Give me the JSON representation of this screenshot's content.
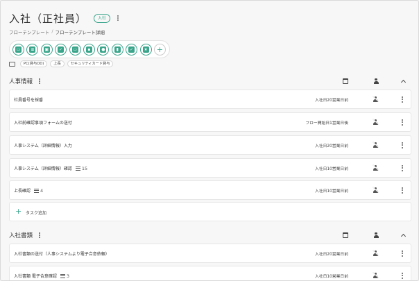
{
  "header": {
    "title": "入社（正社員）",
    "badge": "入社"
  },
  "breadcrumb": {
    "parent": "フローテンプレート",
    "separator": "/",
    "current": "フローテンプレート詳細"
  },
  "icon_group": {
    "icons": [
      "id-card-icon",
      "document-icon",
      "id-card-photo-icon",
      "shield-icon",
      "monitor-icon",
      "truck-icon",
      "person-icon",
      "book-icon",
      "clipboard-check-icon",
      "star-icon"
    ],
    "add_label": "+"
  },
  "tags": [
    "PC(貸与OD)",
    "上長",
    "セキュリティカード貸与"
  ],
  "sections": [
    {
      "title": "人事情報",
      "tasks": [
        {
          "label": "社員番号を採番",
          "sub": "",
          "due": "入社日20営業日前"
        },
        {
          "label": "入社前確認事項フォームの送付",
          "sub": "",
          "due": "フロー開始日1営業日後"
        },
        {
          "label": "人事システム（詳細情報）入力",
          "sub": "",
          "due": "入社日20営業日前"
        },
        {
          "label": "人事システム（詳細情報）確認",
          "sub": "15",
          "due": "入社日10営業日前"
        },
        {
          "label": "上長確認",
          "sub": "4",
          "due": "入社日10営業日前"
        }
      ],
      "add_task_label": "タスク追加"
    },
    {
      "title": "入社書類",
      "tasks": [
        {
          "label": "入社書類の送付（人事システムより電子合意依頼）",
          "sub": "",
          "due": "入社日20営業日前"
        },
        {
          "label": "入社書類 電子合意確認",
          "sub": "3",
          "due": "入社日10営業日前"
        }
      ]
    }
  ],
  "colors": {
    "accent": "#3aa58b",
    "background": "#f7f7f7",
    "card": "#ffffff"
  }
}
